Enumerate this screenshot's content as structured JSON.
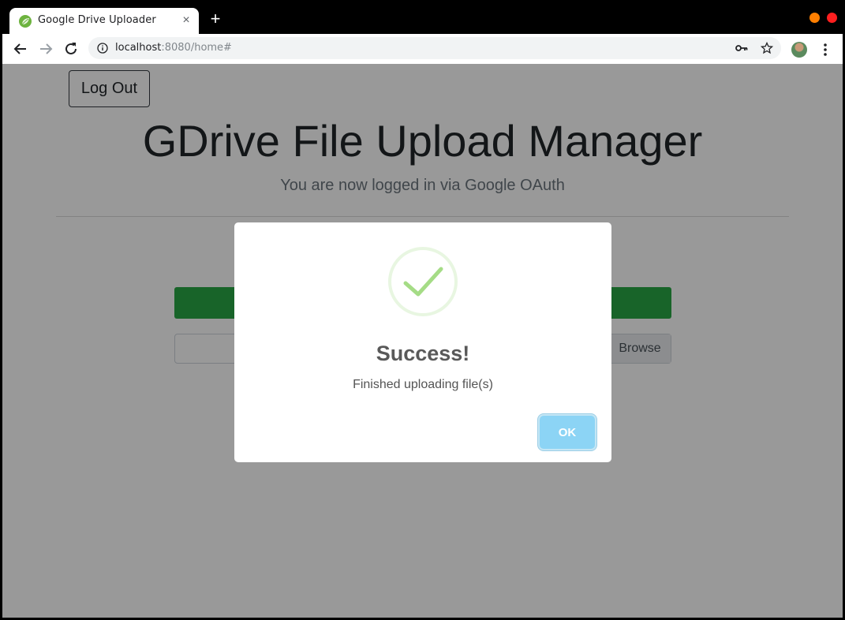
{
  "browser": {
    "tab_title": "Google Drive Uploader",
    "tab_close": "×",
    "new_tab": "+",
    "url_host": "localhost",
    "url_path": ":8080/home#"
  },
  "page": {
    "logout_label": "Log Out",
    "title": "GDrive File Upload Manager",
    "subtitle": "You are now logged in via Google OAuth",
    "browse_label": "Browse"
  },
  "modal": {
    "title": "Success!",
    "text": "Finished uploading file(s)",
    "ok_label": "OK"
  },
  "colors": {
    "upload_bar": "#28a745",
    "ok_button": "#8cd4f5",
    "success_check": "#a5dc86",
    "window_min": "#ff7f00",
    "window_close": "#ff1f1f"
  }
}
